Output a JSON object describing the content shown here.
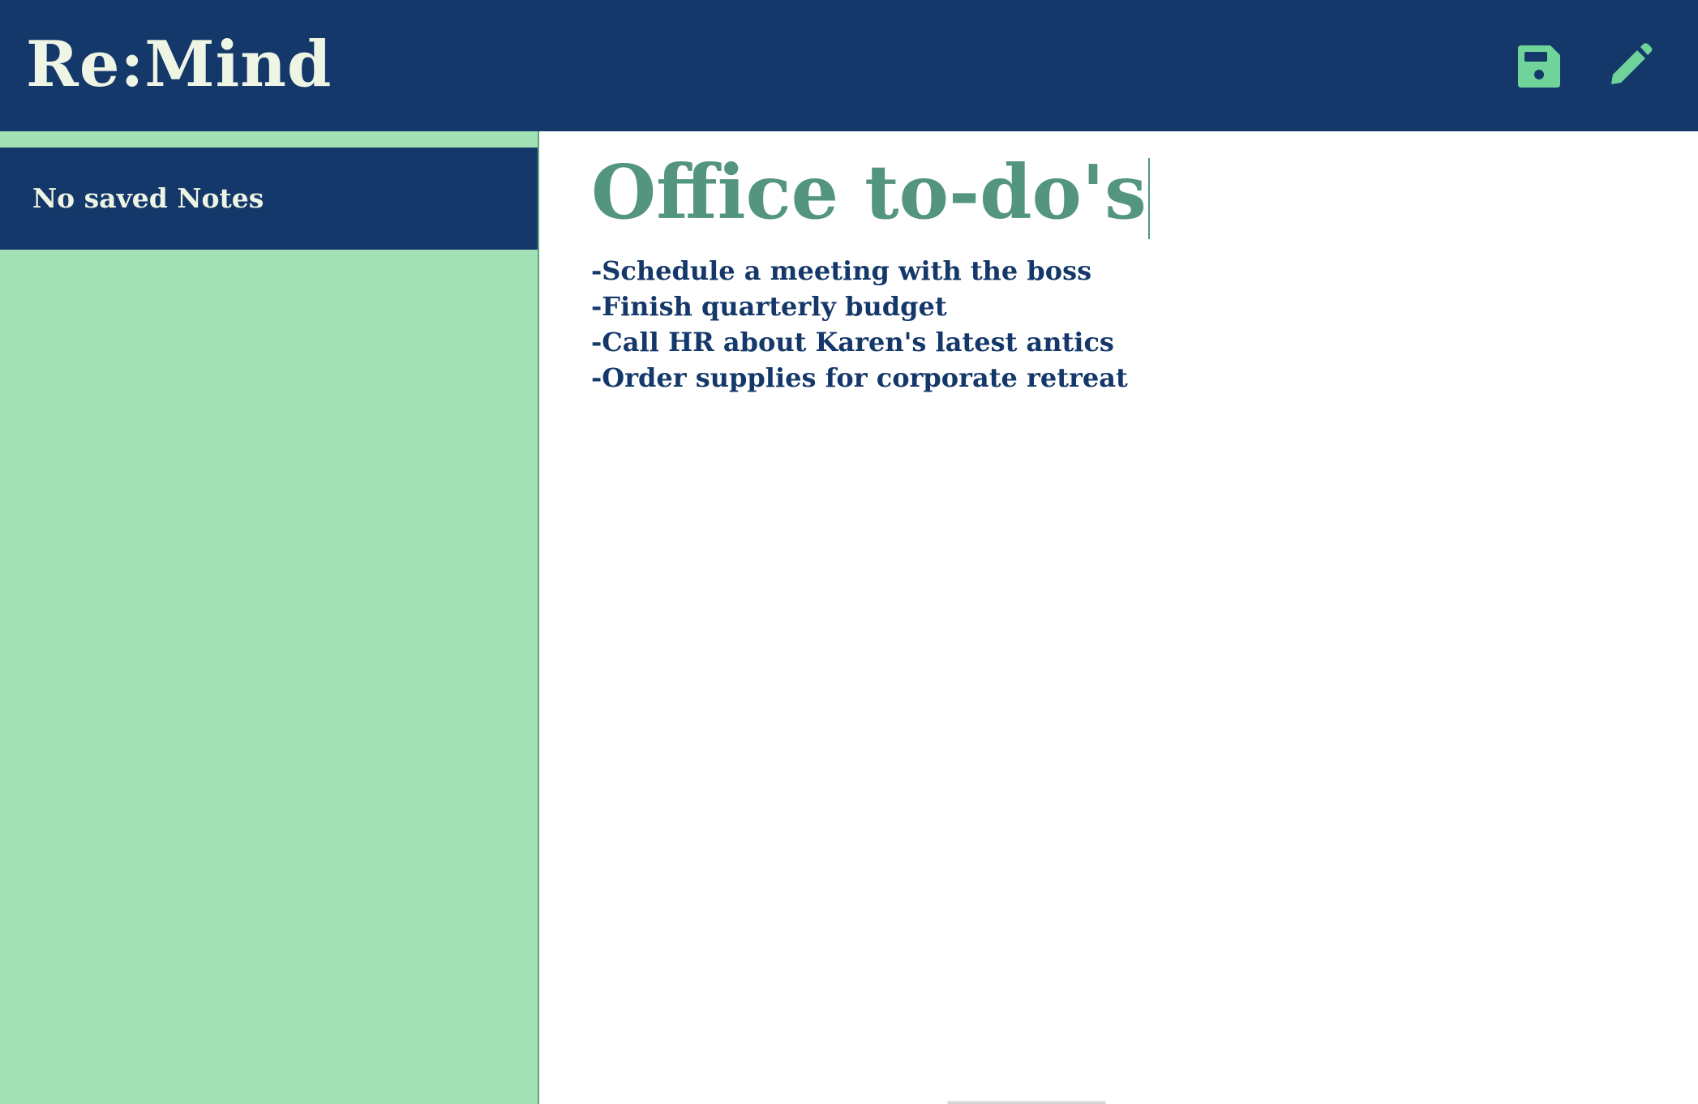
{
  "app": {
    "brand": "Re:Mind"
  },
  "toolbar": {
    "save_icon": "save-icon",
    "new_note_icon": "pencil-icon"
  },
  "sidebar": {
    "items": [
      {
        "label": "No saved Notes"
      }
    ]
  },
  "editor": {
    "title": "Office to-do's",
    "body": "-Schedule a meeting with the boss\n-Finish quarterly budget\n-Call HR about Karen's latest antics\n-Order supplies for corporate retreat"
  },
  "colors": {
    "navy": "#15386a",
    "mint": "#a3e2b5",
    "accent_green": "#6fd39a",
    "title_teal": "#539580",
    "cream": "#eef5e4"
  }
}
